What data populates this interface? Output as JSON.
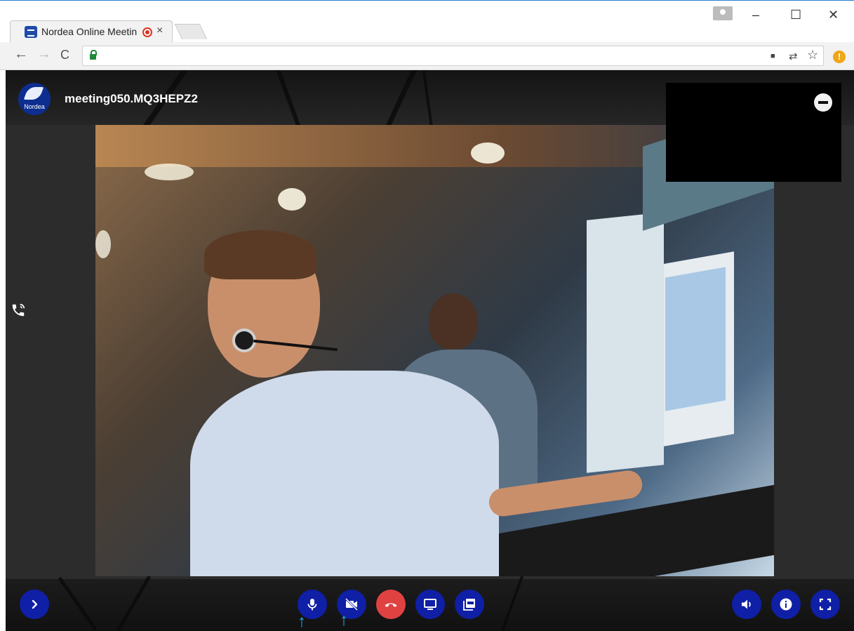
{
  "browser": {
    "tab_title": "Nordea Online Meetin",
    "tab_close": "×",
    "nav": {
      "back": "←",
      "forward": "→",
      "reload": "C"
    },
    "window": {
      "minimize": "–",
      "maximize": "☐",
      "close": "✕"
    },
    "omnibox_icons": {
      "camera": "■",
      "translate": "⇄",
      "star": "☆"
    },
    "alert": "!"
  },
  "meeting": {
    "logo_text": "Nordea",
    "meeting_id": "meeting050.MQ3HEPZ2"
  },
  "controls": {
    "left": [
      {
        "name": "expand-button",
        "icon": "chevron-right-icon"
      }
    ],
    "center": [
      {
        "name": "microphone-button",
        "icon": "microphone-icon"
      },
      {
        "name": "camera-off-button",
        "icon": "video-off-icon"
      },
      {
        "name": "hangup-button",
        "icon": "phone-hangup-icon",
        "color": "#e04242"
      },
      {
        "name": "screen-share-button",
        "icon": "monitor-icon"
      },
      {
        "name": "pdf-button",
        "icon": "pdf-icon"
      }
    ],
    "right": [
      {
        "name": "volume-button",
        "icon": "speaker-icon"
      },
      {
        "name": "info-button",
        "icon": "info-icon"
      },
      {
        "name": "fullscreen-button",
        "icon": "fullscreen-icon"
      }
    ]
  },
  "colors": {
    "accent": "#0f1fa6",
    "hangup": "#e04242",
    "pointer": "#1eaaf0"
  },
  "annotations": {
    "pointer_arrow": "↑"
  }
}
